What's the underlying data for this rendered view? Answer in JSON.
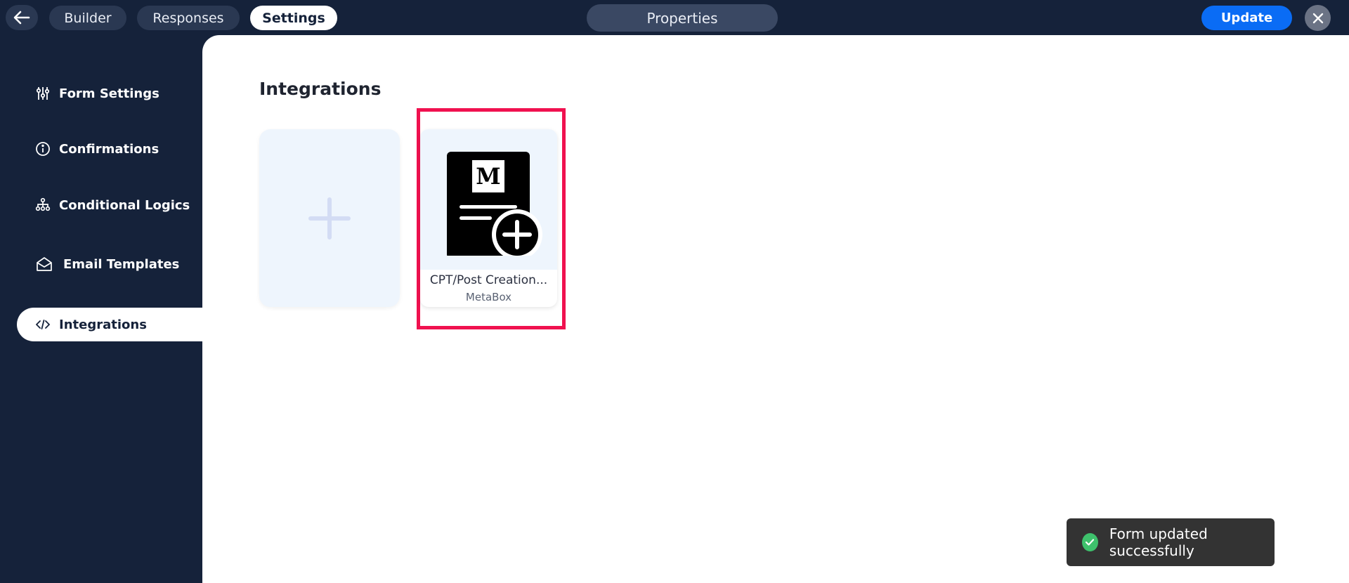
{
  "header": {
    "tabs": [
      {
        "label": "Builder"
      },
      {
        "label": "Responses"
      },
      {
        "label": "Settings"
      }
    ],
    "properties_label": "Properties",
    "update_label": "Update"
  },
  "sidebar": {
    "items": [
      {
        "label": "Form Settings",
        "icon": "sliders-icon"
      },
      {
        "label": "Confirmations",
        "icon": "info-circle-icon"
      },
      {
        "label": "Conditional Logics",
        "icon": "sitemap-icon"
      },
      {
        "label": "Email Templates",
        "icon": "envelope-open-icon"
      },
      {
        "label": "Integrations",
        "icon": "code-icon",
        "active": true
      }
    ]
  },
  "main": {
    "title": "Integrations",
    "integrations": [
      {
        "name": "CPT/Post Creation...",
        "provider": "MetaBox",
        "logo_letter": "M"
      }
    ]
  },
  "toast": {
    "message": "Form updated successfully"
  },
  "colors": {
    "navy": "#15223a",
    "accent": "#0a6cf5",
    "highlight": "#f0114f",
    "success": "#3ec16c"
  }
}
